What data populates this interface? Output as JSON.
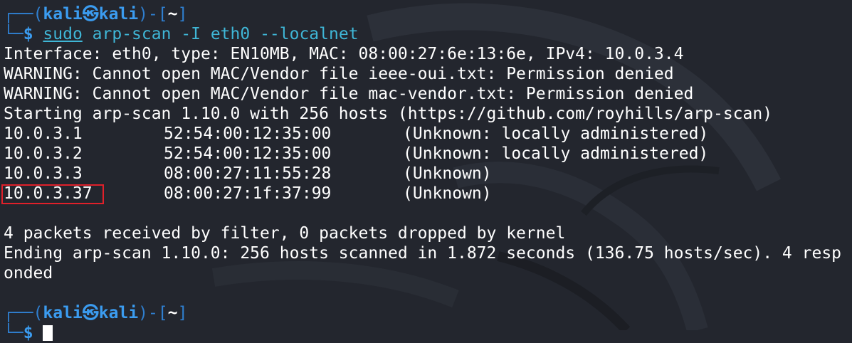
{
  "prompt": {
    "corner_top": "┌──(",
    "user": "kali",
    "skull": "㉿",
    "host": "kali",
    "mid": ")-[",
    "dir": "~",
    "close": "]",
    "corner_bottom": "└─",
    "dollar": "$"
  },
  "command": {
    "sudo": "sudo",
    "rest": "arp-scan -I eth0 --localnet"
  },
  "output": {
    "interface_line": "Interface: eth0, type: EN10MB, MAC: 08:00:27:6e:13:6e, IPv4: 10.0.3.4",
    "warning_1": "WARNING: Cannot open MAC/Vendor file ieee-oui.txt: Permission denied",
    "warning_2": "WARNING: Cannot open MAC/Vendor file mac-vendor.txt: Permission denied",
    "starting": "Starting arp-scan 1.10.0 with 256 hosts (https://github.com/royhills/arp-scan)",
    "hosts": [
      {
        "ip": "10.0.3.1",
        "mac": "52:54:00:12:35:00",
        "vendor": "(Unknown: locally administered)"
      },
      {
        "ip": "10.0.3.2",
        "mac": "52:54:00:12:35:00",
        "vendor": "(Unknown: locally administered)"
      },
      {
        "ip": "10.0.3.3",
        "mac": "08:00:27:11:55:28",
        "vendor": "(Unknown)"
      },
      {
        "ip": "10.0.3.37",
        "mac": "08:00:27:1f:37:99",
        "vendor": "(Unknown)"
      }
    ],
    "packets": "4 packets received by filter, 0 packets dropped by kernel",
    "ending_1": "Ending arp-scan 1.10.0: 256 hosts scanned in 1.872 seconds (136.75 hosts/sec). 4 resp",
    "ending_2": "onded"
  },
  "colors": {
    "background": "#23262e",
    "prompt_blue": "#3b9cf0",
    "command_cyan": "#3fb6d6",
    "highlight_red": "#e0202a"
  }
}
